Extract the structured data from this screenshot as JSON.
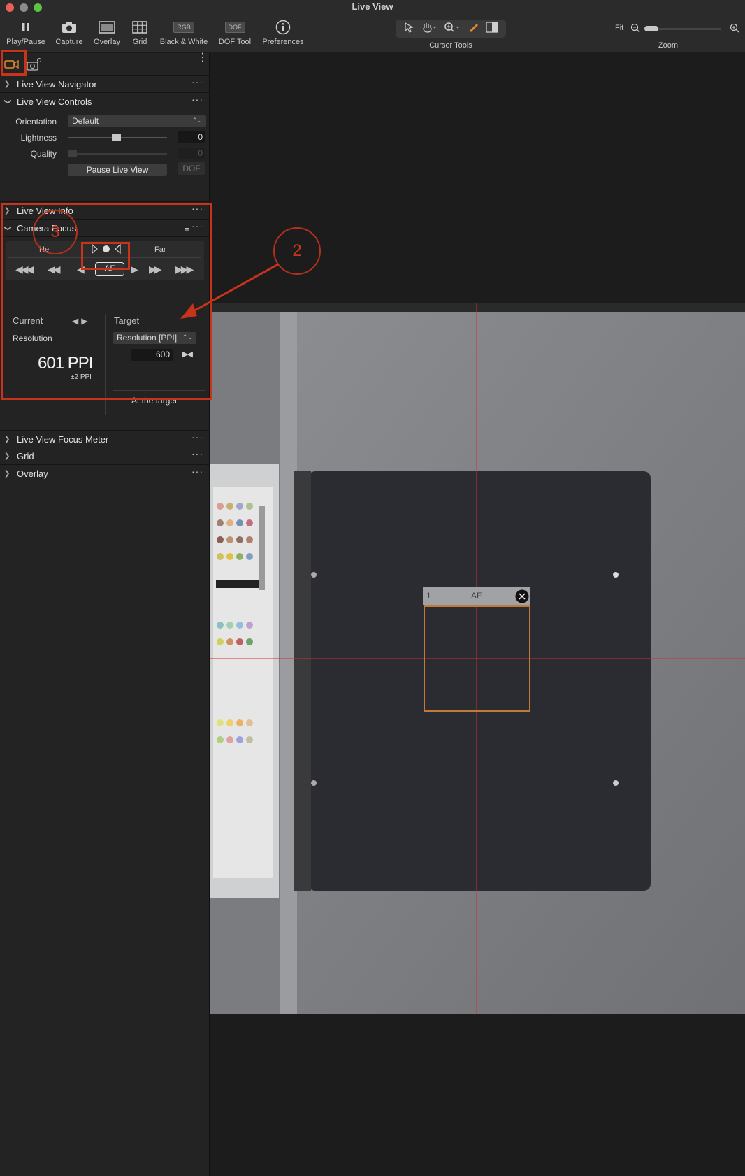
{
  "window": {
    "title": "Live View"
  },
  "toolbar": {
    "items": [
      {
        "label": "Play/Pause",
        "icon": "pause-icon"
      },
      {
        "label": "Capture",
        "icon": "camera-icon"
      },
      {
        "label": "Overlay",
        "icon": "overlay-icon"
      },
      {
        "label": "Grid",
        "icon": "grid-icon"
      },
      {
        "label": "Black & White",
        "icon": "rgb-icon",
        "badge": "RGB"
      },
      {
        "label": "DOF Tool",
        "icon": "dof-icon",
        "badge": "DOF"
      },
      {
        "label": "Preferences",
        "icon": "info-icon"
      }
    ],
    "cursor_tools_label": "Cursor Tools",
    "zoom_label": "Zoom",
    "fit_label": "Fit"
  },
  "sidebar": {
    "sections": {
      "navigator": "Live View Navigator",
      "controls": "Live View Controls",
      "info": "Live View Info",
      "camera_focus": "Camera Focus",
      "focus_meter": "Live View Focus Meter",
      "grid": "Grid",
      "overlay": "Overlay"
    },
    "controls": {
      "orientation_label": "Orientation",
      "orientation_value": "Default",
      "lightness_label": "Lightness",
      "lightness_value": "0",
      "quality_label": "Quality",
      "quality_value": "0",
      "pause_button": "Pause Live View",
      "dof_button": "DOF"
    },
    "camera_focus": {
      "near_label": "Ne",
      "far_label": "Far",
      "af_button": "AF",
      "current_label": "Current",
      "target_label": "Target",
      "resolution_label": "Resolution",
      "target_select": "Resolution [PPI]",
      "target_value": "600",
      "current_value": "601 PPI",
      "current_tolerance": "±2 PPI",
      "status": "At the target"
    }
  },
  "viewer": {
    "af_box_number": "1",
    "af_box_label": "AF"
  },
  "annotations": {
    "step_2": "2",
    "step_3": "3",
    "color": "#c8331b"
  }
}
